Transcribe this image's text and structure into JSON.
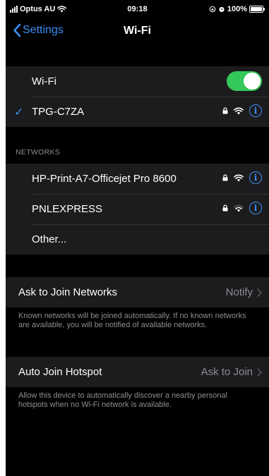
{
  "status_bar": {
    "carrier": "Optus AU",
    "time": "09:18",
    "battery": "100%"
  },
  "nav": {
    "back_label": "Settings",
    "title": "Wi-Fi"
  },
  "wifi": {
    "label": "Wi-Fi",
    "enabled": true,
    "connected_network": "TPG-C7ZA"
  },
  "networks": {
    "header": "NETWORKS",
    "items": [
      {
        "name": "HP-Print-A7-Officejet Pro 8600"
      },
      {
        "name": "PNLEXPRESS"
      }
    ],
    "other_label": "Other..."
  },
  "ask_to_join": {
    "label": "Ask to Join Networks",
    "value": "Notify",
    "footnote": "Known networks will be joined automatically. If no known networks are available, you will be notified of available networks."
  },
  "auto_join_hotspot": {
    "label": "Auto Join Hotspot",
    "value": "Ask to Join",
    "footnote": "Allow this device to automatically discover a nearby personal hotspots when no Wi-Fi network is available."
  },
  "colors": {
    "accent": "#3d8ff5",
    "toggle_on": "#34c759",
    "background": "#000000",
    "cell": "#1c1c1e",
    "secondary_text": "#8e8e93"
  }
}
